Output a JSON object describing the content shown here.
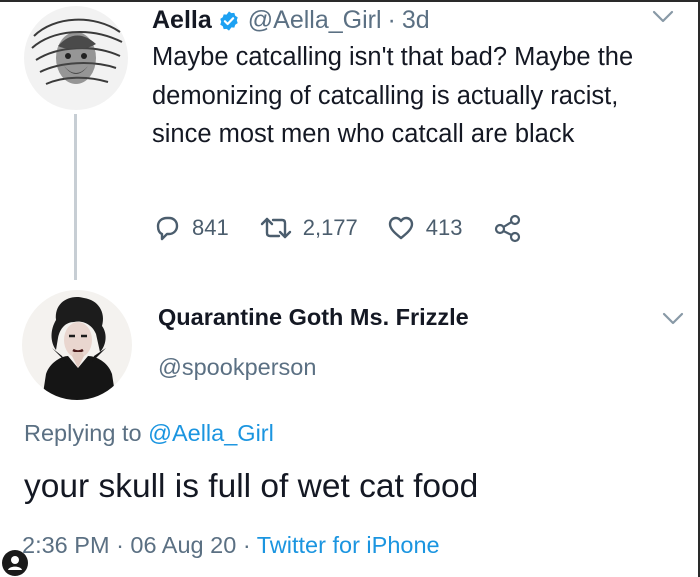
{
  "tweet1": {
    "display_name": "Aella",
    "handle": "@Aella_Girl",
    "separator": "·",
    "age": "3d",
    "verified": true,
    "text": "Maybe catcalling isn't that bad? Maybe the demonizing of catcalling is actually racist, since most men who catcall are black",
    "replies": "841",
    "retweets": "2,177",
    "likes": "413",
    "icons": {
      "reply": "reply-icon",
      "retweet": "retweet-icon",
      "like": "heart-icon",
      "share": "share-icon",
      "menu": "chevron-down-icon",
      "verified": "verified-badge-icon"
    }
  },
  "tweet2": {
    "display_name": "Quarantine Goth Ms. Frizzle",
    "handle": "@spookperson",
    "replying_prefix": "Replying to",
    "replying_to": "@Aella_Girl",
    "text": "your skull is full of wet cat food",
    "time": "2:36 PM",
    "date": "06 Aug 20",
    "separator": "·",
    "source": "Twitter for iPhone"
  },
  "colors": {
    "text_primary": "#141823",
    "text_secondary": "#5b7083",
    "link": "#1b95e0",
    "verified": "#1da1f2",
    "thread_line": "#c7ced4"
  }
}
